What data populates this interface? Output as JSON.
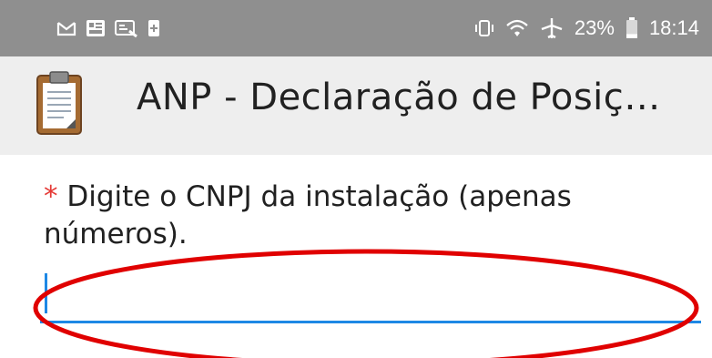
{
  "status_bar": {
    "left_icons": [
      "gmail-icon",
      "photo-app-icon",
      "cast-icon",
      "sim-icon"
    ],
    "battery_percent": "23%",
    "battery_level": 0.23,
    "time": "18:14"
  },
  "app_bar": {
    "icon": "clipboard-icon",
    "title": "ANP - Declaração de Posiç…"
  },
  "form": {
    "required_mark": "*",
    "question": " Digite o CNPJ da instalação (apenas números).",
    "answer_value": ""
  },
  "colors": {
    "accent": "#1e88e5",
    "required": "#e53935",
    "annotation": "#e00000",
    "status_bar": "#8f8f8f",
    "app_bar": "#eeeeee"
  }
}
